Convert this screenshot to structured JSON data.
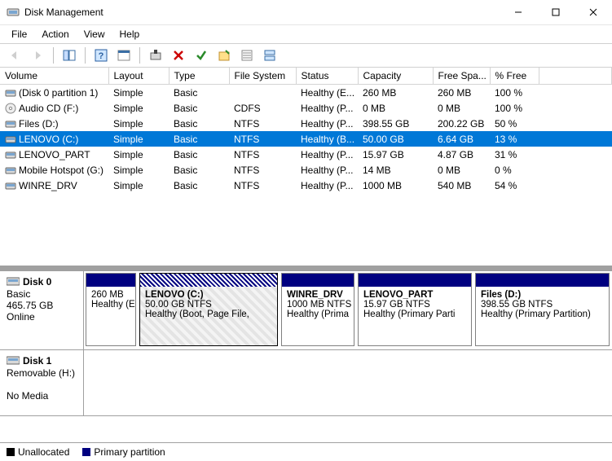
{
  "window": {
    "title": "Disk Management"
  },
  "menubar": [
    "File",
    "Action",
    "View",
    "Help"
  ],
  "cols": {
    "volume": "Volume",
    "layout": "Layout",
    "type": "Type",
    "fs": "File System",
    "status": "Status",
    "capacity": "Capacity",
    "free": "Free Spa...",
    "pct": "% Free"
  },
  "volumes": [
    {
      "icon": "vol",
      "name": "(Disk 0 partition 1)",
      "layout": "Simple",
      "type": "Basic",
      "fs": "",
      "status": "Healthy (E...",
      "capacity": "260 MB",
      "free": "260 MB",
      "pct": "100 %",
      "selected": false
    },
    {
      "icon": "cd",
      "name": "Audio CD (F:)",
      "layout": "Simple",
      "type": "Basic",
      "fs": "CDFS",
      "status": "Healthy (P...",
      "capacity": "0 MB",
      "free": "0 MB",
      "pct": "100 %",
      "selected": false
    },
    {
      "icon": "vol",
      "name": "Files (D:)",
      "layout": "Simple",
      "type": "Basic",
      "fs": "NTFS",
      "status": "Healthy (P...",
      "capacity": "398.55 GB",
      "free": "200.22 GB",
      "pct": "50 %",
      "selected": false
    },
    {
      "icon": "vol",
      "name": "LENOVO (C:)",
      "layout": "Simple",
      "type": "Basic",
      "fs": "NTFS",
      "status": "Healthy (B...",
      "capacity": "50.00 GB",
      "free": "6.64 GB",
      "pct": "13 %",
      "selected": true
    },
    {
      "icon": "vol",
      "name": "LENOVO_PART",
      "layout": "Simple",
      "type": "Basic",
      "fs": "NTFS",
      "status": "Healthy (P...",
      "capacity": "15.97 GB",
      "free": "4.87 GB",
      "pct": "31 %",
      "selected": false
    },
    {
      "icon": "vol",
      "name": "Mobile Hotspot (G:)",
      "layout": "Simple",
      "type": "Basic",
      "fs": "NTFS",
      "status": "Healthy (P...",
      "capacity": "14 MB",
      "free": "0 MB",
      "pct": "0 %",
      "selected": false
    },
    {
      "icon": "vol",
      "name": "WINRE_DRV",
      "layout": "Simple",
      "type": "Basic",
      "fs": "NTFS",
      "status": "Healthy (P...",
      "capacity": "1000 MB",
      "free": "540 MB",
      "pct": "54 %",
      "selected": false
    }
  ],
  "disks": [
    {
      "label": "Disk 0",
      "type": "Basic",
      "size": "465.75 GB",
      "state": "Online",
      "parts": [
        {
          "name": "",
          "line2": "260 MB",
          "line3": "Healthy (EF",
          "w": 62,
          "selected": false
        },
        {
          "name": "LENOVO  (C:)",
          "line2": "50.00 GB NTFS",
          "line3": "Healthy (Boot, Page File,",
          "w": 170,
          "selected": true
        },
        {
          "name": "WINRE_DRV",
          "line2": "1000 MB NTFS",
          "line3": "Healthy (Prima",
          "w": 90,
          "selected": false
        },
        {
          "name": "LENOVO_PART",
          "line2": "15.97 GB NTFS",
          "line3": "Healthy (Primary Parti",
          "w": 140,
          "selected": false
        },
        {
          "name": "Files  (D:)",
          "line2": "398.55 GB NTFS",
          "line3": "Healthy (Primary Partition)",
          "w": 165,
          "selected": false
        }
      ]
    },
    {
      "label": "Disk 1",
      "type": "Removable (H:)",
      "size": "",
      "state": "No Media",
      "parts": []
    }
  ],
  "legend": {
    "unallocated": "Unallocated",
    "primary": "Primary partition"
  }
}
